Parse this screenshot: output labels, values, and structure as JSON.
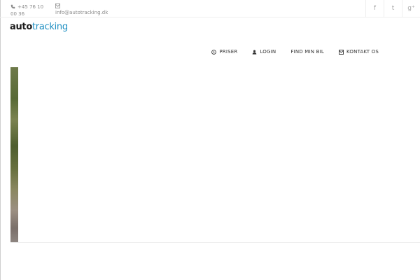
{
  "topbar": {
    "phone": "+45 76 10 00 36",
    "email": "info@autotracking.dk",
    "social": [
      {
        "icon": "facebook-icon",
        "glyph": "f"
      },
      {
        "icon": "twitter-icon",
        "glyph": "t"
      },
      {
        "icon": "google-plus-icon",
        "glyph": "g⁺"
      }
    ]
  },
  "logo": {
    "part1": "auto",
    "part2": "tracking"
  },
  "nav": {
    "items": [
      {
        "label": "PRISER",
        "icon": "dollar-icon"
      },
      {
        "label": "LOGIN",
        "icon": "user-icon"
      },
      {
        "label": "FIND MIN BIL",
        "icon": ""
      },
      {
        "label": "KONTAKT OS",
        "icon": "envelope-icon"
      }
    ]
  },
  "colors": {
    "accent": "#1f8fc2",
    "text": "#333333",
    "muted": "#8a8a8a"
  }
}
